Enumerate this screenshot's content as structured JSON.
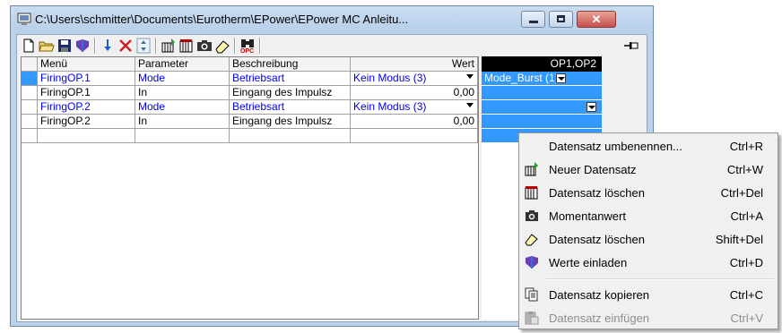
{
  "window": {
    "title": "C:\\Users\\schmitter\\Documents\\Eurotherm\\EPower\\EPower MC Anleitu...",
    "close_glyph": "✕"
  },
  "toolbar": {
    "icons": [
      "new-document-icon",
      "open-folder-icon",
      "save-icon",
      "load-values-icon",
      "download-arrow-icon",
      "delete-x-icon",
      "spin-updown-icon",
      "new-dataset-icon",
      "delete-dataset-icon",
      "snapshot-camera-icon",
      "eraser-icon",
      "opc-binoculars-icon",
      "pin-icon"
    ]
  },
  "grid": {
    "headers": [
      "Menü",
      "Parameter",
      "Beschreibung",
      "Wert"
    ],
    "rows": [
      {
        "menu": "FiringOP.1",
        "param": "Mode",
        "desc": "Betriebsart",
        "value": "Kein Modus (3)",
        "dropdown": true,
        "blue": true
      },
      {
        "menu": "FiringOP.1",
        "param": "In",
        "desc": "Eingang des Impulsz",
        "value": "0,00",
        "dropdown": false,
        "blue": false
      },
      {
        "menu": "FiringOP.2",
        "param": "Mode",
        "desc": "Betriebsart",
        "value": "Kein Modus (3)",
        "dropdown": true,
        "blue": true
      },
      {
        "menu": "FiringOP.2",
        "param": "In",
        "desc": "Eingang des Impulsz",
        "value": "0,00",
        "dropdown": false,
        "blue": false
      }
    ]
  },
  "opcolumn": {
    "header": "OP1,OP2",
    "first_value": "Mode_Burst (1)"
  },
  "menu": {
    "items": [
      {
        "label": "Datensatz umbenennen...",
        "shortcut": "Ctrl+R",
        "icon": "",
        "disabled": false
      },
      {
        "label": "Neuer Datensatz",
        "shortcut": "Ctrl+W",
        "icon": "new-dataset-icon",
        "disabled": false
      },
      {
        "label": "Datensatz löschen",
        "shortcut": "Ctrl+Del",
        "icon": "delete-dataset-icon",
        "disabled": false
      },
      {
        "label": "Momentanwert",
        "shortcut": "Ctrl+A",
        "icon": "snapshot-camera-icon",
        "disabled": false
      },
      {
        "label": "Datensatz löschen",
        "shortcut": "Shift+Del",
        "icon": "eraser-icon",
        "disabled": false
      },
      {
        "label": "Werte einladen",
        "shortcut": "Ctrl+D",
        "icon": "load-values-icon",
        "disabled": false
      },
      {
        "label": "Datensatz kopieren",
        "shortcut": "Ctrl+C",
        "icon": "copy-icon",
        "disabled": false
      },
      {
        "label": "Datensatz einfügen",
        "shortcut": "Ctrl+V",
        "icon": "paste-icon",
        "disabled": true
      }
    ]
  },
  "colors": {
    "selection": "#3399ff",
    "link_blue": "#0000ee",
    "header_black": "#000000"
  }
}
